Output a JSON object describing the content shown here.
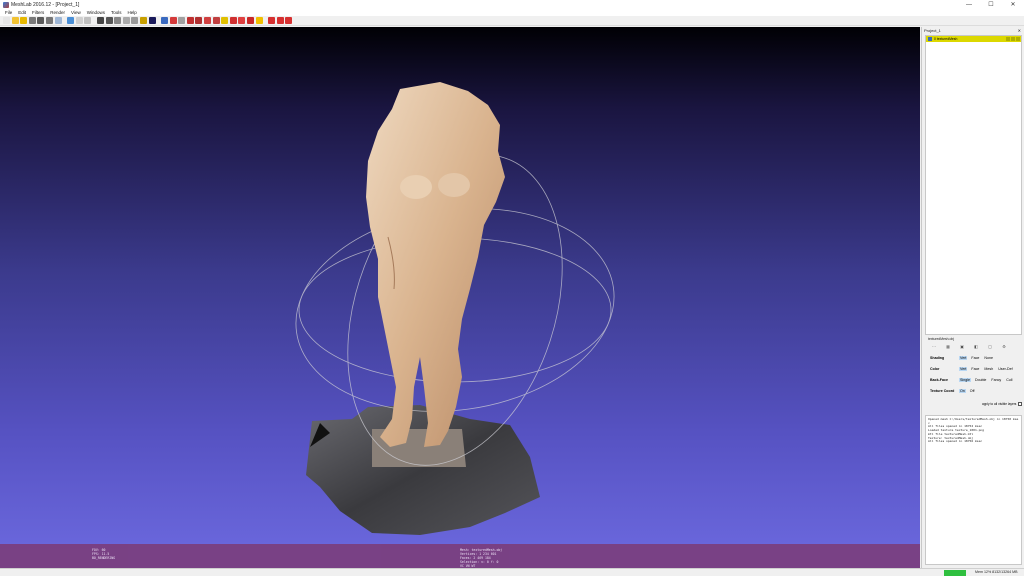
{
  "window": {
    "title": "MeshLab 2016.12 - [Project_1]",
    "controls": [
      "—",
      "☐",
      "✕"
    ]
  },
  "menu": [
    "File",
    "Edit",
    "Filters",
    "Render",
    "View",
    "Windows",
    "Tools",
    "Help"
  ],
  "toolbar": {
    "icons": [
      "new-project-icon",
      "open-project-icon",
      "import-mesh-icon",
      "reload-icon",
      "export-mesh-icon",
      "save-snapshot-icon",
      "show-layers-icon",
      "trackball-icon",
      "fullscreen-icon",
      "bounding-box-icon",
      "points-icon",
      "wireframe-icon",
      "flat-lines-icon",
      "flat-icon",
      "smooth-icon",
      "light-icon",
      "texture-icon",
      "measure-icon",
      "paint-icon",
      "move-icon",
      "select-faces-icon",
      "select-vertices-icon",
      "align-icon",
      "pick-points-icon",
      "rotate-icon",
      "cut-icon",
      "delete-faces-icon",
      "delete-vertices-icon",
      "info-icon",
      "red-tool-1-icon",
      "red-tool-2-icon",
      "red-tool-3-icon"
    ],
    "colors": [
      "#e6e6e6",
      "#f1c232",
      "#e6b800",
      "#7a7a7a",
      "#5a5a5a",
      "#777777",
      "#9fb7d6",
      "#4a8fd6",
      "#d0d0d0",
      "#c0c0c0",
      "#444444",
      "#555555",
      "#888888",
      "#aaaaaa",
      "#999999",
      "#c8a000",
      "#1a1a5a",
      "#3a6ac0",
      "#d43a3a",
      "#a0a0a0",
      "#c03030",
      "#b03030",
      "#d04040",
      "#c04040",
      "#e0c000",
      "#d03030",
      "#e04040",
      "#c82828",
      "#f0c000",
      "#d63030",
      "#d63030",
      "#d63030"
    ]
  },
  "viewport": {
    "info_left": [
      "FOV: 60",
      "FPS:   11.5",
      "BO_RENDERING"
    ],
    "info_mid": [
      "Mesh: texturedMesh.obj",
      "Vertices: 1 234 601",
      "Faces: 2 469 184",
      "Selection: v: 0 f: 0",
      "VC VN WT"
    ]
  },
  "panel": {
    "project_title": "Project_1",
    "layer_name": "0 texturedMesh",
    "decorator_title": "texturedMesh.obj",
    "properties": [
      {
        "label": "Shading",
        "options": [
          "Vert",
          "Face",
          "None"
        ],
        "selected": 0
      },
      {
        "label": "Color",
        "options": [
          "Vert",
          "Face",
          "Mesh",
          "User-Def"
        ],
        "selected": 0
      },
      {
        "label": "Back-Face",
        "options": [
          "Single",
          "Double",
          "Fancy",
          "Cull"
        ],
        "selected": 0
      },
      {
        "label": "Texture Coord",
        "options": [
          "On",
          "Off"
        ],
        "selected": 0
      }
    ],
    "apply_label": "apply to all visible layers",
    "log": "Opened mesh C:/Users/texturedMesh.obj in 18750 msec\nAll files opened in 18752 msec\nLoaded texture texture_1001.png\nmtl file texturedMesh.mtl\nTexture: texturedMesh.obj\nAll files opened in 18756 msec"
  },
  "statusbar": {
    "memory": "Mem 12% 8132/13264 MB"
  }
}
